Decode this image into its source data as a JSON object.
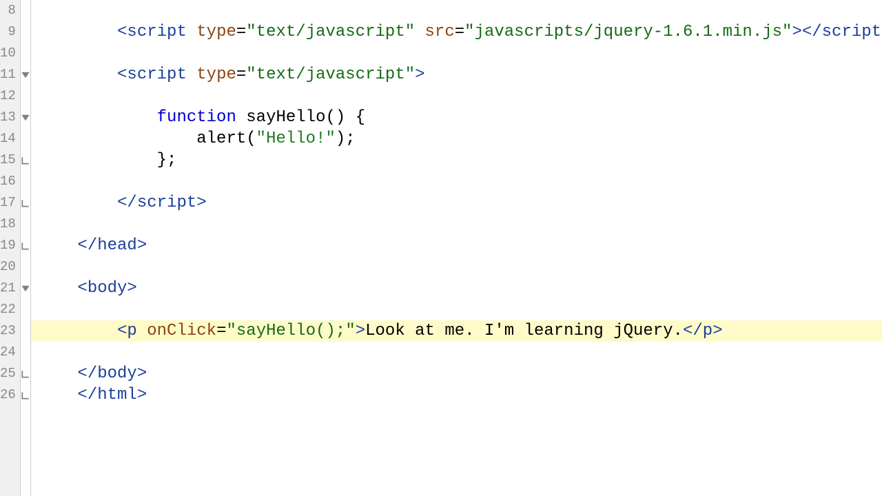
{
  "lines": [
    {
      "num": "8",
      "fold": "",
      "indent": "            ",
      "tokens": []
    },
    {
      "num": "9",
      "fold": "",
      "indent": "        ",
      "tokens": [
        {
          "c": "tag",
          "t": "<script"
        },
        {
          "c": "punc",
          "t": " "
        },
        {
          "c": "attr",
          "t": "type"
        },
        {
          "c": "punc",
          "t": "="
        },
        {
          "c": "attrval",
          "t": "\"text/javascript\""
        },
        {
          "c": "punc",
          "t": " "
        },
        {
          "c": "attr",
          "t": "src"
        },
        {
          "c": "punc",
          "t": "="
        },
        {
          "c": "attrval",
          "t": "\"javascripts/jquery-1.6.1.min.js\""
        },
        {
          "c": "tag",
          "t": ">"
        },
        {
          "c": "tag",
          "t": "</script>"
        }
      ]
    },
    {
      "num": "10",
      "fold": "",
      "indent": "",
      "tokens": []
    },
    {
      "num": "11",
      "fold": "down",
      "indent": "        ",
      "tokens": [
        {
          "c": "tag",
          "t": "<script"
        },
        {
          "c": "punc",
          "t": " "
        },
        {
          "c": "attr",
          "t": "type"
        },
        {
          "c": "punc",
          "t": "="
        },
        {
          "c": "attrval",
          "t": "\"text/javascript\""
        },
        {
          "c": "tag",
          "t": ">"
        }
      ]
    },
    {
      "num": "12",
      "fold": "",
      "indent": "",
      "tokens": []
    },
    {
      "num": "13",
      "fold": "down",
      "indent": "            ",
      "tokens": [
        {
          "c": "kw",
          "t": "function"
        },
        {
          "c": "punc",
          "t": " "
        },
        {
          "c": "fn",
          "t": "sayHello"
        },
        {
          "c": "punc",
          "t": "()"
        },
        {
          "c": "punc",
          "t": " "
        },
        {
          "c": "bracket",
          "t": "{"
        }
      ]
    },
    {
      "num": "14",
      "fold": "",
      "indent": "                ",
      "tokens": [
        {
          "c": "fn",
          "t": "alert"
        },
        {
          "c": "punc",
          "t": "("
        },
        {
          "c": "str",
          "t": "\"Hello!\""
        },
        {
          "c": "punc",
          "t": ");"
        }
      ]
    },
    {
      "num": "15",
      "fold": "end",
      "indent": "            ",
      "tokens": [
        {
          "c": "bracket",
          "t": "}"
        },
        {
          "c": "punc",
          "t": ";"
        }
      ]
    },
    {
      "num": "16",
      "fold": "",
      "indent": "",
      "tokens": []
    },
    {
      "num": "17",
      "fold": "end",
      "indent": "        ",
      "tokens": [
        {
          "c": "tag",
          "t": "</script>"
        }
      ]
    },
    {
      "num": "18",
      "fold": "",
      "indent": "",
      "tokens": []
    },
    {
      "num": "19",
      "fold": "end",
      "indent": "    ",
      "tokens": [
        {
          "c": "tag",
          "t": "</head>"
        }
      ]
    },
    {
      "num": "20",
      "fold": "",
      "indent": "",
      "tokens": []
    },
    {
      "num": "21",
      "fold": "down",
      "indent": "    ",
      "tokens": [
        {
          "c": "tag",
          "t": "<body>"
        }
      ]
    },
    {
      "num": "22",
      "fold": "",
      "indent": "",
      "tokens": []
    },
    {
      "num": "23",
      "fold": "",
      "indent": "        ",
      "hl": true,
      "tokens": [
        {
          "c": "tag",
          "t": "<p"
        },
        {
          "c": "punc",
          "t": " "
        },
        {
          "c": "attr",
          "t": "onClick"
        },
        {
          "c": "punc",
          "t": "="
        },
        {
          "c": "attrval",
          "t": "\"sayHello();\""
        },
        {
          "c": "tag",
          "t": ">"
        },
        {
          "c": "txt",
          "t": "Look at me. I'm learning jQuery."
        },
        {
          "c": "tag",
          "t": "</p>"
        }
      ]
    },
    {
      "num": "24",
      "fold": "",
      "indent": "",
      "tokens": []
    },
    {
      "num": "25",
      "fold": "end",
      "indent": "    ",
      "tokens": [
        {
          "c": "tag",
          "t": "</body>"
        }
      ]
    },
    {
      "num": "26",
      "fold": "end",
      "indent": "    ",
      "tokens": [
        {
          "c": "tag",
          "t": "</html>"
        }
      ]
    }
  ]
}
